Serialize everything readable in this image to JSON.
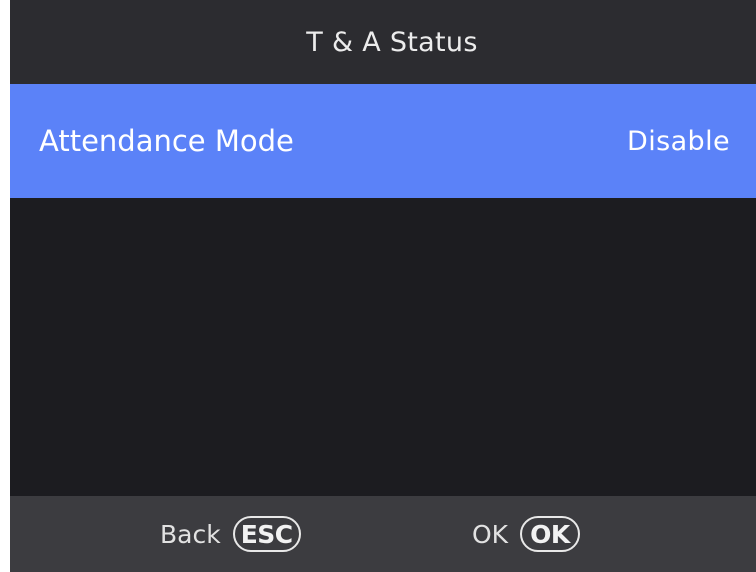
{
  "header": {
    "title": "T & A Status"
  },
  "menu": {
    "items": [
      {
        "label": "Attendance Mode",
        "value": "Disable",
        "selected": true
      }
    ],
    "selected_color": "#5b82f8"
  },
  "footer": {
    "back_label": "Back",
    "back_key": "ESC",
    "ok_label": "OK",
    "ok_key": "OK"
  },
  "colors": {
    "background": "#1c1c20",
    "header_bg": "#2c2c30",
    "footer_bg": "#3c3c40",
    "highlight": "#5b82f8"
  }
}
